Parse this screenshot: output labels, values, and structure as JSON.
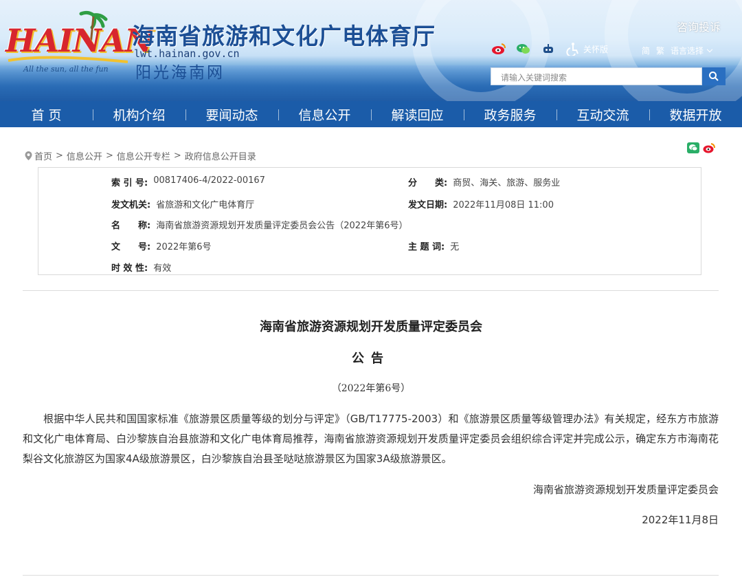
{
  "header": {
    "logo_text": "HAINAN",
    "logo_slogan": "All the sun, all the fun",
    "site_title": "海南省旅游和文化广电体育厅",
    "site_url": "lwt.hainan.gov.cn",
    "site_slogan": "阳光海南网",
    "consult_link": "咨询投诉",
    "care_mode": "关怀版",
    "lang_simplified": "简",
    "lang_traditional": "繁",
    "lang_select": "语言选择",
    "search_placeholder": "请输入关键词搜索",
    "icons": [
      "weibo-icon",
      "wechat-icon",
      "robot-icon",
      "accessibility-icon",
      "search-icon"
    ]
  },
  "nav": {
    "items": [
      "首 页",
      "机构介绍",
      "要闻动态",
      "信息公开",
      "解读回应",
      "政务服务",
      "互动交流",
      "数据开放"
    ]
  },
  "breadcrumb": {
    "items": [
      "首页",
      "信息公开",
      "信息公开专栏",
      "政府信息公开目录"
    ],
    "separator": ">"
  },
  "meta": {
    "index_label": "索 引 号:",
    "index_value": "00817406-4/2022-00167",
    "category_label": "分　　类:",
    "category_value": "商贸、海关、旅游、服务业",
    "issuer_label": "发文机关:",
    "issuer_value": "省旅游和文化广电体育厅",
    "date_label": "发文日期:",
    "date_value": "2022年11月08日 11:00",
    "name_label": "名　　称:",
    "name_value": "海南省旅游资源规划开发质量评定委员会公告（2022年第6号）",
    "docno_label": "文　　号:",
    "docno_value": "2022年第6号",
    "subject_label": "主 题 词:",
    "subject_value": "无",
    "validity_label": "时 效 性:",
    "validity_value": "有效"
  },
  "article": {
    "title": "海南省旅游资源规划开发质量评定委员会",
    "subtitle": "公告",
    "number": "（2022年第6号）",
    "body": "根据中华人民共和国国家标准《旅游景区质量等级的划分与评定》（GB/T17775-2003）和《旅游景区质量等级管理办法》有关规定，经东方市旅游和文化广电体育局、白沙黎族自治县旅游和文化广电体育局推荐，海南省旅游资源规划开发质量评定委员会组织综合评定并完成公示，确定东方市海南花梨谷文化旅游区为国家4A级旅游景区，白沙黎族自治县圣哒哒旅游景区为国家3A级旅游景区。",
    "signature": "海南省旅游资源规划开发质量评定委员会",
    "date": "2022年11月8日"
  },
  "colors": {
    "nav_bg": "#1b5ca9",
    "title_blue": "#1c4f95",
    "weibo_red": "#e6162d",
    "wechat_green": "#2aae67"
  }
}
